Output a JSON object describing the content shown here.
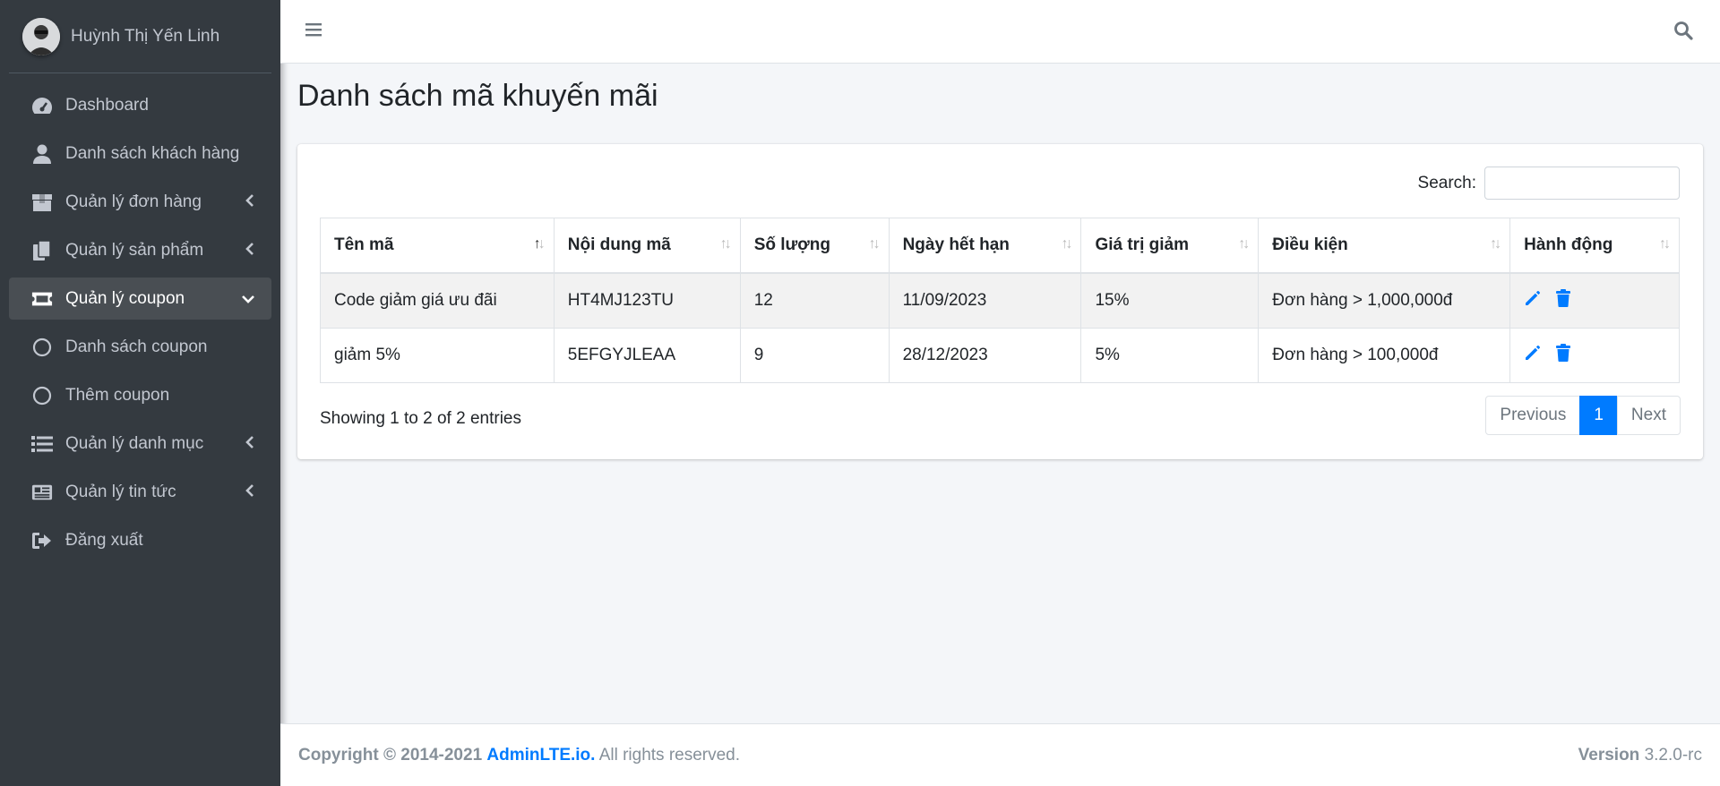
{
  "user": {
    "name": "Huỳnh Thị Yến Linh"
  },
  "sidebar": {
    "items": [
      {
        "label": "Dashboard",
        "icon": "dashboard-gauge-icon"
      },
      {
        "label": "Danh sách khách hàng",
        "icon": "user-icon"
      },
      {
        "label": "Quản lý đơn hàng",
        "icon": "box-icon",
        "expandable": true
      },
      {
        "label": "Quản lý sản phẩm",
        "icon": "copy-icon",
        "expandable": true
      },
      {
        "label": "Quản lý coupon",
        "icon": "ticket-icon",
        "expandable": true,
        "active": true,
        "expanded": true
      },
      {
        "label": "Danh sách coupon",
        "icon": "circle-icon",
        "sub": true
      },
      {
        "label": "Thêm coupon",
        "icon": "circle-icon",
        "sub": true
      },
      {
        "label": "Quản lý danh mục",
        "icon": "list-icon",
        "expandable": true
      },
      {
        "label": "Quản lý tin tức",
        "icon": "newspaper-icon",
        "expandable": true
      },
      {
        "label": "Đăng xuất",
        "icon": "sign-out-icon"
      }
    ]
  },
  "page": {
    "title": "Danh sách mã khuyến mãi"
  },
  "table": {
    "search_label": "Search:",
    "search_value": "",
    "columns": [
      "Tên mã",
      "Nội dung mã",
      "Số lượng",
      "Ngày hết hạn",
      "Giá trị giảm",
      "Điều kiện",
      "Hành động"
    ],
    "sorted_column": 0,
    "rows": [
      [
        "Code giảm giá ưu đãi",
        "HT4MJ123TU",
        "12",
        "11/09/2023",
        "15%",
        "Đơn hàng > 1,000,000đ"
      ],
      [
        "giảm 5%",
        "5EFGYJLEAA",
        "9",
        "28/12/2023",
        "5%",
        "Đơn hàng > 100,000đ"
      ]
    ],
    "info": "Showing 1 to 2 of 2 entries",
    "pagination": {
      "previous": "Previous",
      "current": "1",
      "next": "Next"
    }
  },
  "footer": {
    "copyright": "Copyright © 2014-2021",
    "link": "AdminLTE.io.",
    "rights": "All rights reserved.",
    "version_label": "Version",
    "version": "3.2.0-rc"
  },
  "colors": {
    "sidebar_bg": "#343a40",
    "accent": "#007bff",
    "active_item": "#494e53"
  }
}
